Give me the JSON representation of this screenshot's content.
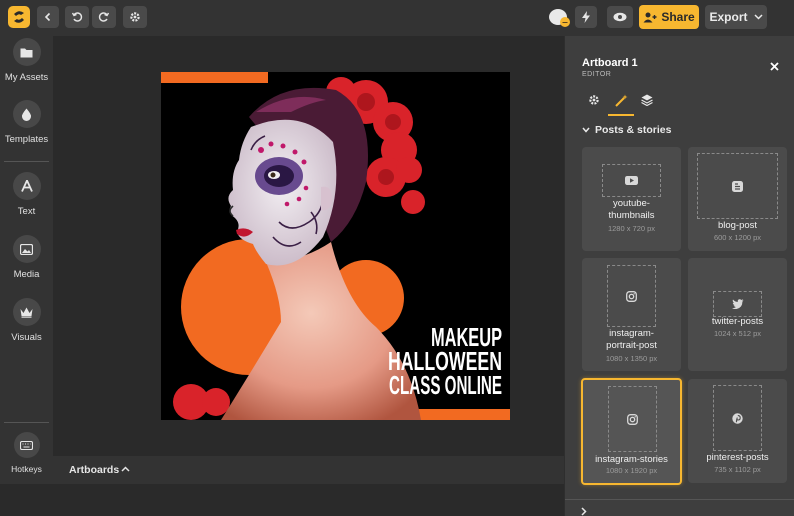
{
  "topbar": {
    "share_label": "Share",
    "export_label": "Export"
  },
  "sidebar": {
    "items": [
      {
        "label": "My Assets"
      },
      {
        "label": "Templates"
      },
      {
        "label": "Text"
      },
      {
        "label": "Media"
      },
      {
        "label": "Visuals"
      },
      {
        "label": "Hotkeys"
      }
    ]
  },
  "canvas": {
    "poster_lines": [
      "MAKEUP",
      "HALLOWEEN",
      "CLASS ONLINE"
    ],
    "colors": {
      "accent_orange": "#f26a21",
      "background": "#000000"
    }
  },
  "artboards_bar": {
    "label": "Artboards"
  },
  "panel": {
    "title": "Artboard 1",
    "subtitle": "EDITOR",
    "section": "Posts & stories",
    "cards": [
      {
        "name": "youtube-\nthumbnails",
        "size": "1280 x 720 px"
      },
      {
        "name": "blog-post",
        "size": "600 x 1200 px"
      },
      {
        "name": "instagram-\nportrait-post",
        "size": "1080 x 1350 px"
      },
      {
        "name": "twitter-posts",
        "size": "1024 x 512 px"
      },
      {
        "name": "instagram-stories",
        "size": "1080 x 1920 px"
      },
      {
        "name": "pinterest-posts",
        "size": "735 x 1102 px"
      }
    ]
  },
  "accent": "#f7b730"
}
